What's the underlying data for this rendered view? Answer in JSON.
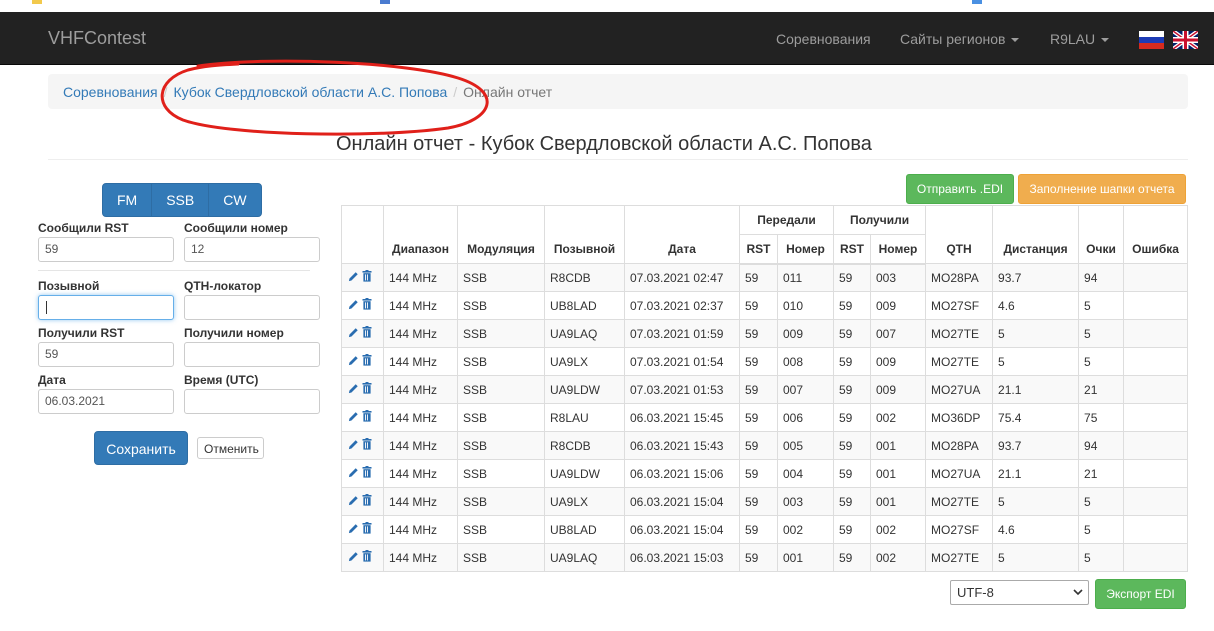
{
  "navbar": {
    "brand": "VHFContest",
    "items": [
      {
        "label": "Соревнования",
        "dropdown": false
      },
      {
        "label": "Сайты регионов",
        "dropdown": true
      },
      {
        "label": "R9LAU",
        "dropdown": true
      }
    ],
    "flags": [
      "russian-flag-icon",
      "uk-flag-icon"
    ]
  },
  "breadcrumb": {
    "items": [
      "Соревнования",
      "Кубок Свердловской области А.С. Попова"
    ],
    "active": "Онлайн отчет"
  },
  "page": {
    "title": "Онлайн отчет - Кубок Свердловской области А.С. Попова"
  },
  "form": {
    "modes": [
      "FM",
      "SSB",
      "CW"
    ],
    "sent_rst_label": "Сообщили RST",
    "sent_rst_value": "59",
    "sent_num_label": "Сообщили номер",
    "sent_num_value": "12",
    "callsign_label": "Позывной",
    "callsign_value": "",
    "qth_label": "QTH-локатор",
    "qth_value": "",
    "rcvd_rst_label": "Получили RST",
    "rcvd_rst_value": "59",
    "rcvd_num_label": "Получили номер",
    "rcvd_num_value": "",
    "date_label": "Дата",
    "date_value": "06.03.2021",
    "time_label": "Время (UTC)",
    "time_value": "",
    "save": "Сохранить",
    "cancel": "Отменить"
  },
  "actions": {
    "send_edi": "Отправить .EDI",
    "fill_header": "Заполнение шапки отчета",
    "encoding": "UTF-8",
    "export_edi": "Экспорт EDI"
  },
  "table": {
    "group_sent": "Передали",
    "group_rcvd": "Получили",
    "headers": {
      "band": "Диапазон",
      "mode": "Модуляция",
      "call": "Позывной",
      "date": "Дата",
      "s_rst": "RST",
      "s_num": "Номер",
      "r_rst": "RST",
      "r_num": "Номер",
      "qth": "QTH",
      "dist": "Дистанция",
      "points": "Очки",
      "error": "Ошибка"
    },
    "rows": [
      {
        "band": "144 MHz",
        "mode": "SSB",
        "call": "R8CDB",
        "date": "07.03.2021 02:47",
        "s_rst": "59",
        "s_num": "011",
        "r_rst": "59",
        "r_num": "003",
        "qth": "MO28PA",
        "dist": "93.7",
        "points": "94",
        "error": ""
      },
      {
        "band": "144 MHz",
        "mode": "SSB",
        "call": "UB8LAD",
        "date": "07.03.2021 02:37",
        "s_rst": "59",
        "s_num": "010",
        "r_rst": "59",
        "r_num": "009",
        "qth": "MO27SF",
        "dist": "4.6",
        "points": "5",
        "error": ""
      },
      {
        "band": "144 MHz",
        "mode": "SSB",
        "call": "UA9LAQ",
        "date": "07.03.2021 01:59",
        "s_rst": "59",
        "s_num": "009",
        "r_rst": "59",
        "r_num": "007",
        "qth": "MO27TE",
        "dist": "5",
        "points": "5",
        "error": ""
      },
      {
        "band": "144 MHz",
        "mode": "SSB",
        "call": "UA9LX",
        "date": "07.03.2021 01:54",
        "s_rst": "59",
        "s_num": "008",
        "r_rst": "59",
        "r_num": "009",
        "qth": "MO27TE",
        "dist": "5",
        "points": "5",
        "error": ""
      },
      {
        "band": "144 MHz",
        "mode": "SSB",
        "call": "UA9LDW",
        "date": "07.03.2021 01:53",
        "s_rst": "59",
        "s_num": "007",
        "r_rst": "59",
        "r_num": "009",
        "qth": "MO27UA",
        "dist": "21.1",
        "points": "21",
        "error": ""
      },
      {
        "band": "144 MHz",
        "mode": "SSB",
        "call": "R8LAU",
        "date": "06.03.2021 15:45",
        "s_rst": "59",
        "s_num": "006",
        "r_rst": "59",
        "r_num": "002",
        "qth": "MO36DP",
        "dist": "75.4",
        "points": "75",
        "error": ""
      },
      {
        "band": "144 MHz",
        "mode": "SSB",
        "call": "R8CDB",
        "date": "06.03.2021 15:43",
        "s_rst": "59",
        "s_num": "005",
        "r_rst": "59",
        "r_num": "001",
        "qth": "MO28PA",
        "dist": "93.7",
        "points": "94",
        "error": ""
      },
      {
        "band": "144 MHz",
        "mode": "SSB",
        "call": "UA9LDW",
        "date": "06.03.2021 15:06",
        "s_rst": "59",
        "s_num": "004",
        "r_rst": "59",
        "r_num": "001",
        "qth": "MO27UA",
        "dist": "21.1",
        "points": "21",
        "error": ""
      },
      {
        "band": "144 MHz",
        "mode": "SSB",
        "call": "UA9LX",
        "date": "06.03.2021 15:04",
        "s_rst": "59",
        "s_num": "003",
        "r_rst": "59",
        "r_num": "001",
        "qth": "MO27TE",
        "dist": "5",
        "points": "5",
        "error": ""
      },
      {
        "band": "144 MHz",
        "mode": "SSB",
        "call": "UB8LAD",
        "date": "06.03.2021 15:04",
        "s_rst": "59",
        "s_num": "002",
        "r_rst": "59",
        "r_num": "002",
        "qth": "MO27SF",
        "dist": "4.6",
        "points": "5",
        "error": ""
      },
      {
        "band": "144 MHz",
        "mode": "SSB",
        "call": "UA9LAQ",
        "date": "06.03.2021 15:03",
        "s_rst": "59",
        "s_num": "001",
        "r_rst": "59",
        "r_num": "002",
        "qth": "MO27TE",
        "dist": "5",
        "points": "5",
        "error": ""
      }
    ]
  },
  "colors": {
    "navbar": "#222222",
    "primary": "#337ab7",
    "success": "#5cb85c",
    "warning": "#f0ad4e",
    "annotation": "#e0201a"
  }
}
